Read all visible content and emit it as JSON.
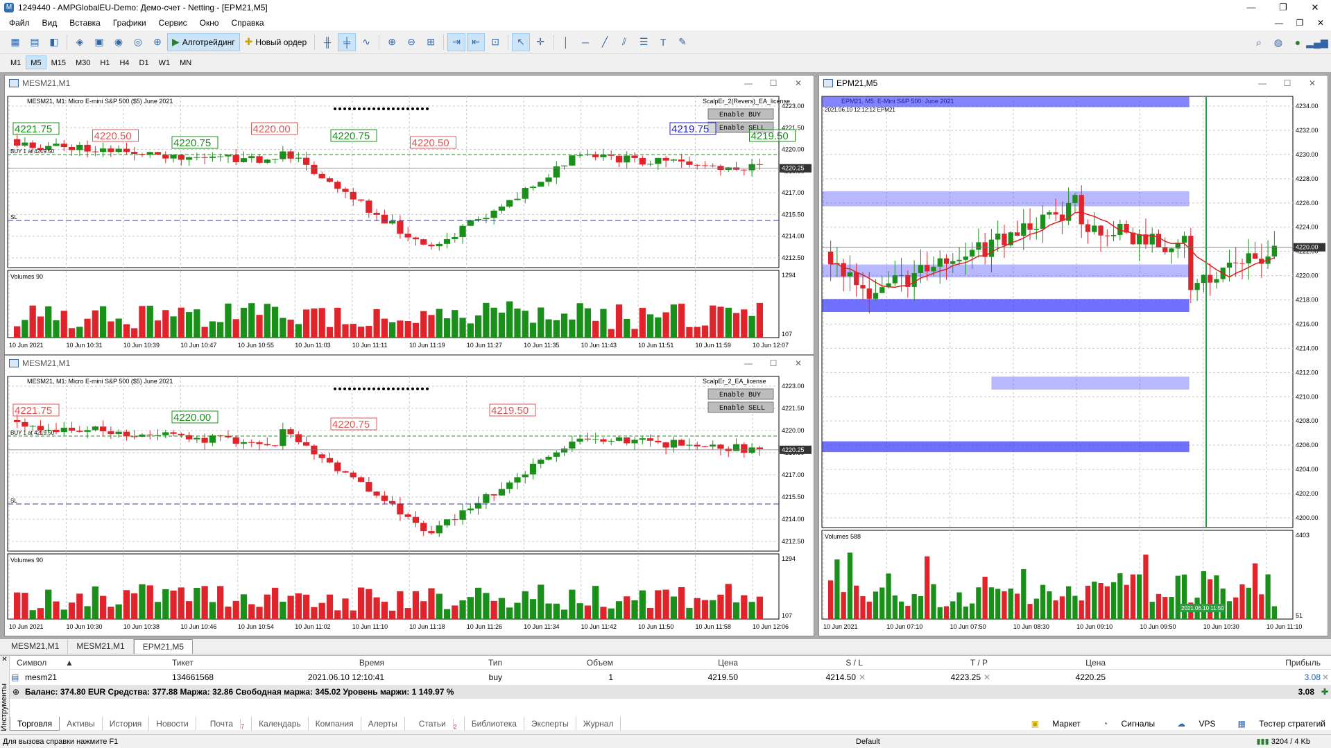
{
  "app": {
    "title": "1249440 - AMPGlobalEU-Demo: Демо-счет - Netting - [EPM21,M5]"
  },
  "menu": [
    "Файл",
    "Вид",
    "Вставка",
    "Графики",
    "Сервис",
    "Окно",
    "Справка"
  ],
  "toolbar": {
    "algo_label": "Алготрейдинг",
    "order_label": "Новый ордер"
  },
  "timeframes": [
    "M1",
    "M5",
    "M15",
    "M30",
    "H1",
    "H4",
    "D1",
    "W1",
    "MN"
  ],
  "active_timeframe": "M5",
  "colors": {
    "bull": "#1a8f1a",
    "bear": "#e0242b",
    "grid": "#c8c8c8",
    "zone": "#3333ff",
    "ma_fast": "#dd2222",
    "ma_slow": "#33bb33"
  },
  "windows": [
    {
      "caption": "MESM21,M1",
      "info": "MESM21, M1: Micro E-mini S&P 500 ($5) June 2021",
      "ea": "ScalpEr_2(Revers)_EA_license",
      "buy_label": "BUY 1 at 4219.50",
      "sl_label": "SL",
      "btn_buy": "Enable BUY",
      "btn_sell": "Enable SELL",
      "vol_label": "Volumes 90",
      "vol_max": "1294",
      "vol_min": "107",
      "price_tag": "4220.25",
      "y_ticks": [
        "4223.00",
        "4221.50",
        "4220.00",
        "4218.50",
        "4217.00",
        "4215.50",
        "4214.00",
        "4212.50"
      ],
      "x_ticks": [
        "10 Jun 2021",
        "10 Jun 10:31",
        "10 Jun 10:39",
        "10 Jun 10:47",
        "10 Jun 10:55",
        "10 Jun 11:03",
        "10 Jun 11:11",
        "10 Jun 11:19",
        "10 Jun 11:27",
        "10 Jun 11:35",
        "10 Jun 11:43",
        "10 Jun 11:51",
        "10 Jun 11:59",
        "10 Jun 12:07"
      ],
      "labels": [
        {
          "t": "4221.75",
          "c": "g"
        },
        {
          "t": "4220.50",
          "c": "r"
        },
        {
          "t": "4220.75",
          "c": "g"
        },
        {
          "t": "4220.00",
          "c": "r"
        },
        {
          "t": "4220.75",
          "c": "g"
        },
        {
          "t": "4220.50",
          "c": "r"
        },
        {
          "t": "4219.75",
          "c": "b"
        },
        {
          "t": "4219.50",
          "c": "g"
        }
      ]
    },
    {
      "caption": "MESM21,M1",
      "info": "MESM21, M1: Micro E-mini S&P 500 ($5) June 2021",
      "ea": "ScalpEr_2_EA_license",
      "buy_label": "BUY 1 at 4219.50",
      "sl_label": "SL",
      "btn_buy": "Enable BUY",
      "btn_sell": "Enable SELL",
      "vol_label": "Volumes 90",
      "vol_max": "1294",
      "vol_min": "107",
      "price_tag": "4220.25",
      "y_ticks": [
        "4223.00",
        "4221.50",
        "4220.00",
        "4218.50",
        "4217.00",
        "4215.50",
        "4214.00",
        "4212.50"
      ],
      "x_ticks": [
        "10 Jun 2021",
        "10 Jun 10:30",
        "10 Jun 10:38",
        "10 Jun 10:46",
        "10 Jun 10:54",
        "10 Jun 11:02",
        "10 Jun 11:10",
        "10 Jun 11:18",
        "10 Jun 11:26",
        "10 Jun 11:34",
        "10 Jun 11:42",
        "10 Jun 11:50",
        "10 Jun 11:58",
        "10 Jun 12:06"
      ],
      "labels": [
        {
          "t": "4221.75",
          "c": "r"
        },
        {
          "t": "4220.00",
          "c": "g"
        },
        {
          "t": "4220.75",
          "c": "r"
        },
        {
          "t": "4219.50",
          "c": "r"
        }
      ]
    },
    {
      "caption": "EPM21,M5",
      "info": "EPM21, M5: E-Mini S&P 500: June 2021",
      "sub": "2021.06.10 12:12:12 EPM21",
      "vol_label": "Volumes 588",
      "vol_max": "4403",
      "vol_min": "51",
      "price_tag": "4220.00",
      "time_tag": "2021.06.10 11:50",
      "y_ticks": [
        "4234.00",
        "4232.00",
        "4230.00",
        "4228.00",
        "4226.00",
        "4224.00",
        "4222.00",
        "4220.00",
        "4218.00",
        "4216.00",
        "4214.00",
        "4212.00",
        "4210.00",
        "4208.00",
        "4206.00",
        "4204.00",
        "4202.00",
        "4200.00"
      ],
      "x_ticks": [
        "10 Jun 2021",
        "10 Jun 07:10",
        "10 Jun 07:50",
        "10 Jun 08:30",
        "10 Jun 09:10",
        "10 Jun 09:50",
        "10 Jun 10:30",
        "10 Jun 11:10"
      ]
    }
  ],
  "chart_tabs": [
    "MESM21,M1",
    "MESM21,M1",
    "EPM21,M5"
  ],
  "terminal": {
    "side_label": "Инструменты",
    "columns": [
      "Символ",
      "Тикет",
      "Время",
      "Тип",
      "Объем",
      "Цена",
      "S / L",
      "T / P",
      "Цена",
      "Прибыль"
    ],
    "row": {
      "symbol": "mesm21",
      "ticket": "134661568",
      "time": "2021.06.10 12:10:41",
      "type": "buy",
      "volume": "1",
      "price": "4219.50",
      "sl": "4214.50",
      "tp": "4223.25",
      "cur": "4220.25",
      "profit": "3.08"
    },
    "balance": "Баланс: 374.80 EUR  Средства: 377.88  Маржа: 32.86  Свободная маржа: 345.02  Уровень маржи: 1 149.97 %",
    "total": "3.08",
    "tabs": [
      "Торговля",
      "Активы",
      "История",
      "Новости",
      "Почта",
      "Календарь",
      "Компания",
      "Алерты",
      "Статьи",
      "Библиотека",
      "Эксперты",
      "Журнал"
    ],
    "right_tabs": [
      "Маркет",
      "Сигналы",
      "VPS",
      "Тестер стратегий"
    ]
  },
  "status": {
    "help": "Для вызова справки нажмите F1",
    "profile": "Default",
    "traffic": "3204 / 4 Kb"
  }
}
